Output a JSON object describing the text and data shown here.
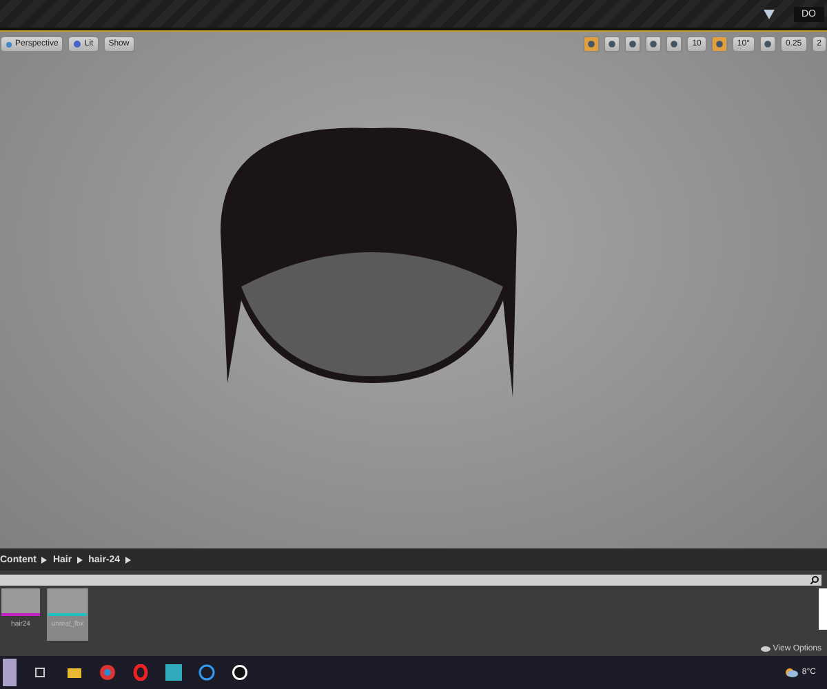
{
  "title_bar": {
    "tab_text": "DO"
  },
  "viewport": {
    "left_buttons": [
      {
        "label": "Perspective",
        "kind": "camera"
      },
      {
        "label": "Lit",
        "kind": "lit"
      },
      {
        "label": "Show",
        "kind": "plain"
      }
    ],
    "snap": {
      "grid": "10",
      "rotation": "10°",
      "scale": "0.25",
      "camera_speed": "2"
    }
  },
  "content_browser": {
    "breadcrumbs": [
      "Content",
      "Hair",
      "hair-24"
    ],
    "assets": [
      {
        "name": "hair24",
        "color": "#c020c0",
        "selected": false
      },
      {
        "name": "unreal_fbx",
        "color": "#20c0c0",
        "selected": true
      }
    ],
    "view_options": "View Options"
  },
  "taskbar": {
    "weather": "8°C",
    "apps": [
      {
        "kind": "folder"
      },
      {
        "kind": "chrome"
      },
      {
        "kind": "opera"
      },
      {
        "kind": "m"
      },
      {
        "kind": "c"
      },
      {
        "kind": "unreal"
      }
    ]
  }
}
